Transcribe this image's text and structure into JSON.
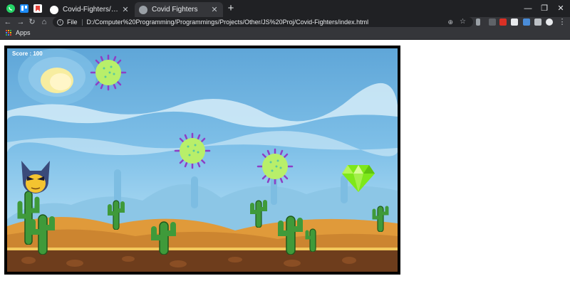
{
  "browser": {
    "pinned_tabs": [
      {
        "icon": "whatsapp-icon",
        "color": "#25d366"
      },
      {
        "icon": "trello-board-icon",
        "color": "#1d8cf8"
      },
      {
        "icon": "bookmark-app-icon",
        "color": "#e8453c"
      }
    ],
    "tabs": [
      {
        "title": "Covid-Fighters/game.js at main",
        "icon": "github-icon",
        "active": false
      },
      {
        "title": "Covid Fighters",
        "icon": "globe-icon",
        "active": true
      }
    ],
    "address": {
      "scheme_label": "File",
      "url": "D:/Computer%20Programming/Programmings/Projects/Other/JS%20Proj/Covid-Fighters/index.html"
    },
    "bookmarks_bar": {
      "apps_label": "Apps"
    },
    "colors": {
      "tabstrip": "#202124",
      "toolbar": "#35363a",
      "text": "#e8eaed"
    }
  },
  "game": {
    "title": "Covid Fighters",
    "score_text": "Score : 100",
    "player": {
      "icon": "wolverine-player-icon"
    },
    "viruses": [
      {
        "icon": "covid-virus-icon"
      },
      {
        "icon": "covid-virus-icon"
      },
      {
        "icon": "covid-virus-icon"
      }
    ],
    "goal": {
      "icon": "green-gem-icon",
      "color": "#7ee81a"
    },
    "colors": {
      "sky": "#6db5e0",
      "sand": "#e09a3a",
      "ground": "#6e3d1c",
      "cactus": "#3f9a3a"
    }
  }
}
